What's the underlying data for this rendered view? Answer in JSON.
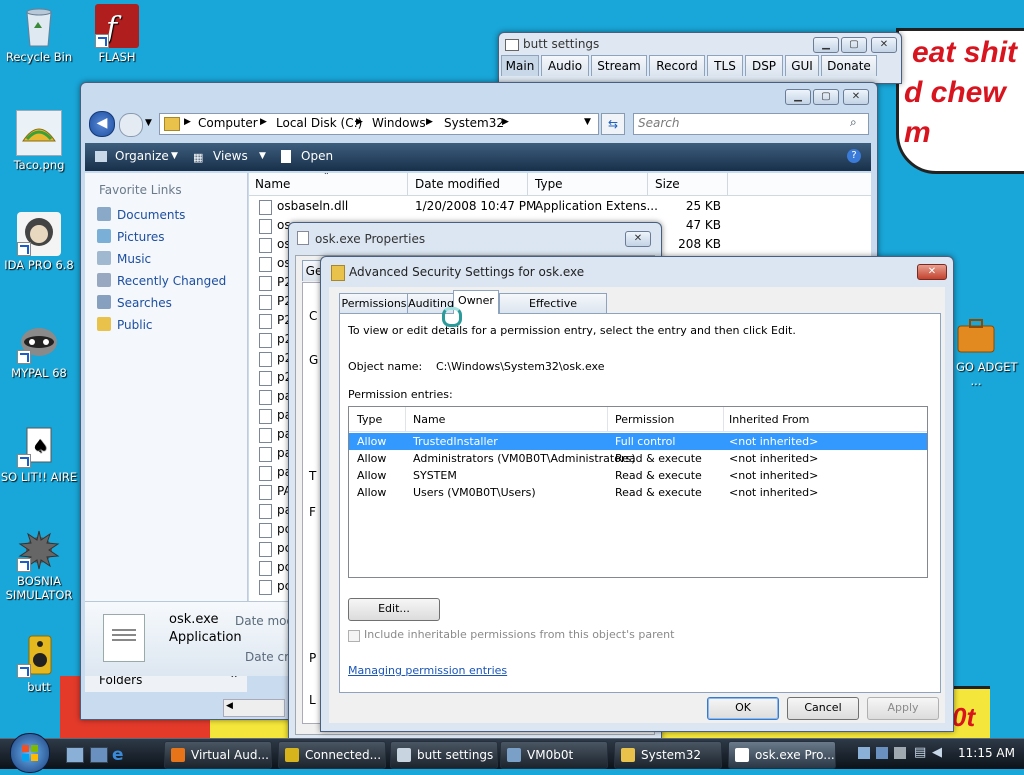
{
  "desktop": {
    "icons": [
      {
        "label": "Recycle Bin",
        "icon": "recycle-bin-icon"
      },
      {
        "label": "FLASH PLAYER P...",
        "icon": "flash-player-icon"
      },
      {
        "label": "Taco.png",
        "icon": "taco-image-icon"
      },
      {
        "label": "IDA PRO 6.8",
        "icon": "ida-pro-icon"
      },
      {
        "label": "MYPAL 68",
        "icon": "mypal-icon"
      },
      {
        "label": "SO LIT!! AIRE",
        "icon": "solitaire-icon"
      },
      {
        "label": "BOSNIA SIMULATOR",
        "icon": "bosnia-simulator-icon"
      },
      {
        "label": "butt",
        "icon": "butt-icon"
      },
      {
        "label": "GO GO ADGET ...",
        "icon": "gadget-briefcase-icon"
      }
    ],
    "wallpaper_text": [
      "eat shit",
      "d chew",
      "m",
      "0t"
    ]
  },
  "butt": {
    "title": "butt settings",
    "tabs": [
      "Main",
      "Audio",
      "Stream",
      "Record",
      "TLS",
      "DSP",
      "GUI",
      "Donate"
    ],
    "active_tab": "Main"
  },
  "explorer": {
    "breadcrumb": [
      "Computer",
      "Local Disk (C:)",
      "Windows",
      "System32"
    ],
    "search_placeholder": "Search",
    "toolbar": {
      "organize": "Organize",
      "views": "Views",
      "open": "Open"
    },
    "nav_header": "Favorite Links",
    "nav_items": [
      "Documents",
      "Pictures",
      "Music",
      "Recently Changed",
      "Searches",
      "Public"
    ],
    "folders_label": "Folders",
    "columns": [
      "Name",
      "Date modified",
      "Type",
      "Size"
    ],
    "files": [
      {
        "name": "osbaseln.dll",
        "date": "1/20/2008 10:47 PM",
        "type": "Application Extens...",
        "size": "25 KB"
      },
      {
        "name": "os",
        "date": "",
        "type": "",
        "size": "47 KB"
      },
      {
        "name": "os",
        "date": "",
        "type": "",
        "size": "208 KB"
      },
      {
        "name": "os",
        "date": "",
        "type": "",
        "size": ""
      },
      {
        "name": "P2",
        "date": "",
        "type": "",
        "size": ""
      },
      {
        "name": "P2",
        "date": "",
        "type": "",
        "size": ""
      },
      {
        "name": "P2",
        "date": "",
        "type": "",
        "size": ""
      },
      {
        "name": "p2",
        "date": "",
        "type": "",
        "size": ""
      },
      {
        "name": "p2",
        "date": "",
        "type": "",
        "size": ""
      },
      {
        "name": "p2",
        "date": "",
        "type": "",
        "size": ""
      },
      {
        "name": "pa",
        "date": "",
        "type": "",
        "size": ""
      },
      {
        "name": "pa",
        "date": "",
        "type": "",
        "size": ""
      },
      {
        "name": "pa",
        "date": "",
        "type": "",
        "size": ""
      },
      {
        "name": "pa",
        "date": "",
        "type": "",
        "size": ""
      },
      {
        "name": "pa",
        "date": "",
        "type": "",
        "size": ""
      },
      {
        "name": "PA",
        "date": "",
        "type": "",
        "size": ""
      },
      {
        "name": "pa",
        "date": "",
        "type": "",
        "size": ""
      },
      {
        "name": "pc",
        "date": "",
        "type": "",
        "size": ""
      },
      {
        "name": "pc",
        "date": "",
        "type": "",
        "size": ""
      },
      {
        "name": "pc",
        "date": "",
        "type": "",
        "size": ""
      },
      {
        "name": "pc",
        "date": "",
        "type": "",
        "size": ""
      }
    ],
    "details": {
      "name": "osk.exe",
      "type": "Application",
      "date_modified_label": "Date mod",
      "date_created_label": "Date cre"
    }
  },
  "props": {
    "title": "osk.exe Properties",
    "tab_fragment": "Ge",
    "side_letters": [
      "C",
      "G",
      "T",
      "F",
      "P",
      "L"
    ]
  },
  "adv": {
    "title": "Advanced Security Settings for osk.exe",
    "tabs": [
      "Permissions",
      "Auditing",
      "Owner",
      "Effective Permissions"
    ],
    "active_tab": "Owner",
    "instruction": "To view or edit details for a permission entry, select the entry and then click Edit.",
    "object_label": "Object name:",
    "object_value": "C:\\Windows\\System32\\osk.exe",
    "entries_label": "Permission entries:",
    "columns": [
      "Type",
      "Name",
      "Permission",
      "Inherited From"
    ],
    "entries": [
      {
        "type": "Allow",
        "name": "TrustedInstaller",
        "permission": "Full control",
        "inherited": "<not inherited>"
      },
      {
        "type": "Allow",
        "name": "Administrators (VM0B0T\\Administrators)",
        "permission": "Read & execute",
        "inherited": "<not inherited>"
      },
      {
        "type": "Allow",
        "name": "SYSTEM",
        "permission": "Read & execute",
        "inherited": "<not inherited>"
      },
      {
        "type": "Allow",
        "name": "Users (VM0B0T\\Users)",
        "permission": "Read & execute",
        "inherited": "<not inherited>"
      }
    ],
    "selected_entry": "TrustedInstaller",
    "edit_button": "Edit...",
    "checkbox_label": "Include inheritable permissions from this object's parent",
    "link": "Managing permission entries",
    "ok": "OK",
    "cancel": "Cancel",
    "apply": "Apply"
  },
  "taskbar": {
    "buttons": [
      {
        "label": "Virtual Aud...",
        "icon": "firefox-icon",
        "color": "#e8741a"
      },
      {
        "label": "Connected...",
        "icon": "butt-speaker-icon",
        "color": "#d8b41c"
      },
      {
        "label": "butt settings",
        "icon": "window-icon",
        "color": "#c8d4e0"
      },
      {
        "label": "VM0b0t",
        "icon": "terminal-icon",
        "color": "#7aa0c8"
      },
      {
        "label": "System32",
        "icon": "folder-icon",
        "color": "#e8c24a"
      },
      {
        "label": "osk.exe Pro...",
        "icon": "properties-icon",
        "color": "#ffffff"
      }
    ],
    "clock": "11:15 AM"
  }
}
